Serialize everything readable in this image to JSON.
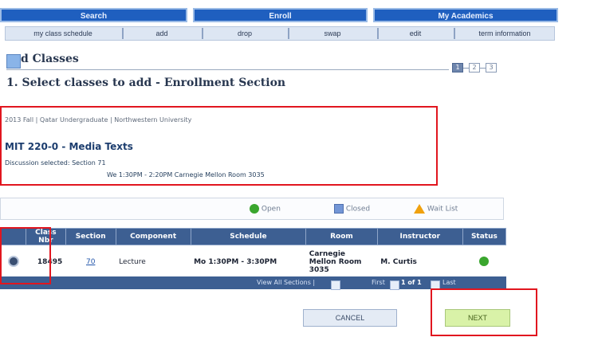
{
  "top_nav": [
    {
      "label": "Search"
    },
    {
      "label": "Enroll"
    },
    {
      "label": "My Academics"
    }
  ],
  "sub_nav": [
    {
      "label": "my class schedule"
    },
    {
      "label": "add"
    },
    {
      "label": "drop"
    },
    {
      "label": "swap"
    },
    {
      "label": "edit"
    },
    {
      "label": "term information"
    }
  ],
  "page": {
    "title": "Add Classes",
    "title_visible": "d Classes",
    "subtitle": "1. Select classes to add - Enrollment Section",
    "steps": [
      "1",
      "2",
      "3"
    ],
    "active_step": 1
  },
  "class_info": {
    "term_line": "2013 Fall | Qatar Undergraduate | Northwestern University",
    "course": "MIT  220-0 - Media Texts",
    "discussion_label": "Discussion selected:  Section 71",
    "discussion_schedule": "We 1:30PM - 2:20PM   Carnegie Mellon Room 3035"
  },
  "legend": {
    "open": "Open",
    "closed": "Closed",
    "wait_list": "Wait List"
  },
  "table": {
    "headers": [
      "",
      "Class Nbr",
      "Section",
      "Component",
      "Schedule",
      "Room",
      "Instructor",
      "Status"
    ],
    "rows": [
      {
        "class_nbr": "18495",
        "section": "70",
        "component": "Lecture",
        "schedule": "Mo 1:30PM - 3:30PM",
        "room": "Carnegie Mellon Room 3035",
        "instructor": "M. Curtis",
        "status": "Open"
      }
    ]
  },
  "footer": {
    "view_all": "View All Sections |",
    "first": "First",
    "count": "1 of 1",
    "last": "Last"
  },
  "buttons": {
    "cancel": "CANCEL",
    "next": "NEXT"
  },
  "colors": {
    "nav_blue": "#1f5fbf",
    "header_blue": "#3d5f92",
    "highlight_red": "#e1161f",
    "open_green": "#3aa62e",
    "next_green": "#d9f2a8"
  }
}
